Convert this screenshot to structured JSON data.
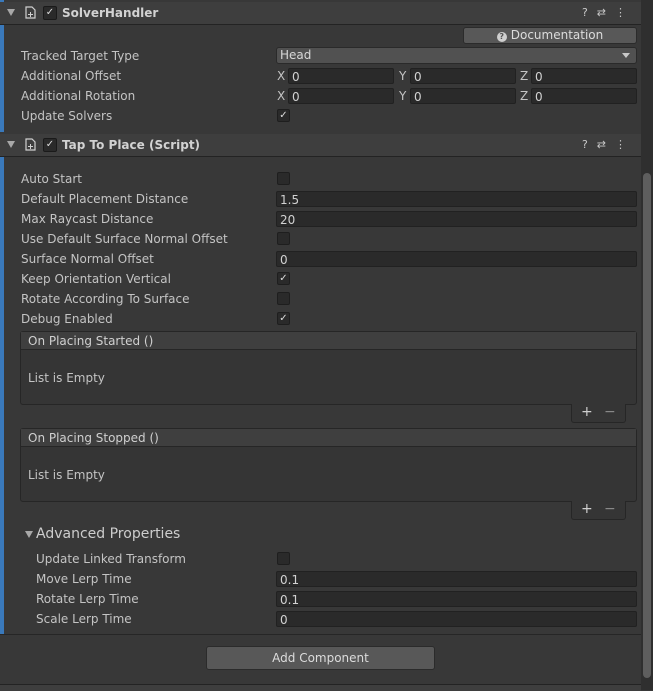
{
  "solver_handler": {
    "title": "SolverHandler",
    "enabled": true,
    "documentation_button": "Documentation",
    "tracked_target_type": {
      "label": "Tracked Target Type",
      "value": "Head"
    },
    "additional_offset": {
      "label": "Additional Offset",
      "x_label": "X",
      "y_label": "Y",
      "z_label": "Z",
      "x": "0",
      "y": "0",
      "z": "0"
    },
    "additional_rotation": {
      "label": "Additional Rotation",
      "x_label": "X",
      "y_label": "Y",
      "z_label": "Z",
      "x": "0",
      "y": "0",
      "z": "0"
    },
    "update_solvers": {
      "label": "Update Solvers",
      "checked": true
    }
  },
  "tap_to_place": {
    "title": "Tap To Place (Script)",
    "enabled": true,
    "fields": {
      "auto_start": {
        "label": "Auto Start",
        "checked": false
      },
      "default_placement_distance": {
        "label": "Default Placement Distance",
        "value": "1.5"
      },
      "max_raycast_distance": {
        "label": "Max Raycast Distance",
        "value": "20"
      },
      "use_default_surface_normal_offset": {
        "label": "Use Default Surface Normal Offset",
        "checked": false
      },
      "surface_normal_offset": {
        "label": "Surface Normal Offset",
        "value": "0"
      },
      "keep_orientation_vertical": {
        "label": "Keep Orientation Vertical",
        "checked": true
      },
      "rotate_according_to_surface": {
        "label": "Rotate According To Surface",
        "checked": false
      },
      "debug_enabled": {
        "label": "Debug Enabled",
        "checked": true
      }
    },
    "events": [
      {
        "title": "On Placing Started ()",
        "empty_text": "List is Empty",
        "add": "+",
        "remove": "−"
      },
      {
        "title": "On Placing Stopped ()",
        "empty_text": "List is Empty",
        "add": "+",
        "remove": "−"
      }
    ],
    "advanced": {
      "title": "Advanced Properties",
      "update_linked_transform": {
        "label": "Update Linked Transform",
        "checked": false
      },
      "move_lerp_time": {
        "label": "Move Lerp Time",
        "value": "0.1"
      },
      "rotate_lerp_time": {
        "label": "Rotate Lerp Time",
        "value": "0.1"
      },
      "scale_lerp_time": {
        "label": "Scale Lerp Time",
        "value": "0"
      }
    }
  },
  "add_component_button": "Add Component",
  "icons": {
    "help": "help-icon",
    "presets": "presets-icon",
    "menu": "kebab-menu-icon"
  },
  "colors": {
    "background": "#383838",
    "field": "#2a2a2a",
    "accent_bar": "#3a79bb"
  }
}
